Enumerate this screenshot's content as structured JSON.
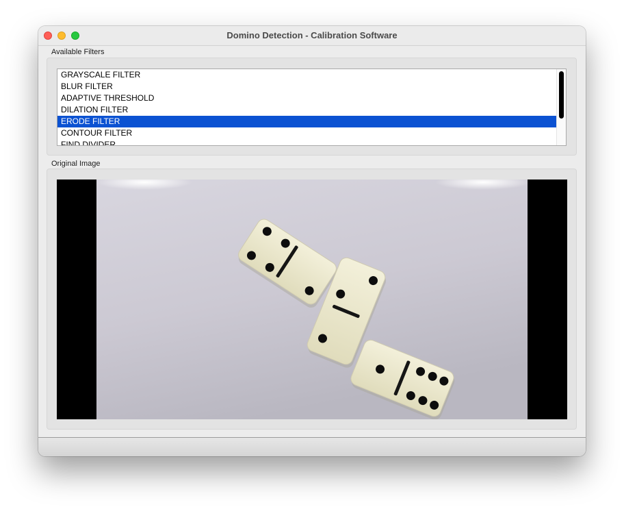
{
  "window": {
    "title": "Domino Detection - Calibration Software"
  },
  "filters_group": {
    "label": "Available Filters",
    "items": [
      "GRAYSCALE FILTER",
      "BLUR FILTER",
      "ADAPTIVE THRESHOLD",
      "DILATION FILTER",
      "ERODE FILTER",
      "CONTOUR FILTER",
      "FIND DIVIDER"
    ],
    "selected": "ERODE FILTER"
  },
  "image_group": {
    "label": "Original Image"
  },
  "colors": {
    "selection": "#0b52d2",
    "close": "#ff5f57",
    "minimize": "#febc2e",
    "maximize": "#28c840"
  }
}
